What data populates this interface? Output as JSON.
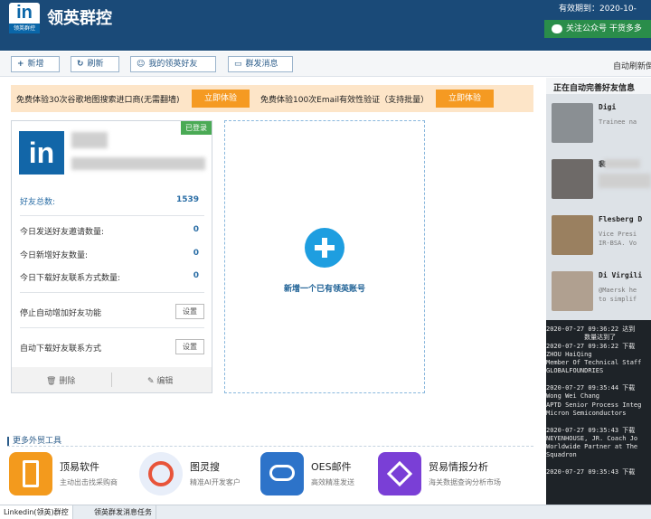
{
  "app": {
    "logo_text": "in",
    "logo_sub": "领英群控",
    "title": "领英群控",
    "expiry": "有效期到：2020-10-",
    "follow": "关注公众号 干货多多"
  },
  "toolbar": {
    "add": "新增",
    "refresh": "刷新",
    "friends": "我的领英好友",
    "message": "群发消息",
    "auto_refresh": "自动刷新倒"
  },
  "promo": {
    "text1": "免费体验30次谷歌地图搜索进口商(无需翻墙)",
    "btn1": "立即体验",
    "text2": "免费体验100次Email有效性验证（支持批量）",
    "btn2": "立即体验"
  },
  "account": {
    "status": "已登录",
    "logo": "in",
    "friends_total_label": "好友总数:",
    "friends_total": "1539",
    "rows": [
      {
        "label": "今日发送好友邀请数量:",
        "value": "0"
      },
      {
        "label": "今日新增好友数量:",
        "value": "0"
      },
      {
        "label": "今日下载好友联系方式数量:",
        "value": "0"
      }
    ],
    "stop_add": "停止自动增加好友功能",
    "auto_download": "自动下载好友联系方式",
    "set": "设置",
    "delete": "删除",
    "edit": "编辑"
  },
  "add_account": {
    "label": "新增一个已有领英账号"
  },
  "tools": {
    "header": "更多外贸工具",
    "items": [
      {
        "name": "顶易软件",
        "desc": "主动出击找采购商",
        "color": "#f39a1d"
      },
      {
        "name": "图灵搜",
        "desc": "精准AI开发客户",
        "color": "#e8eef9"
      },
      {
        "name": "OES邮件",
        "desc": "高效精准发送",
        "color": "#2d73c9"
      },
      {
        "name": "贸易情报分析",
        "desc": "海关数据查询分析市场",
        "color": "#7a3fd6"
      }
    ]
  },
  "tabs": [
    "Linkedin(领英)群控",
    "领英群发消息任务"
  ],
  "side": {
    "header": "正在自动完善好友信息",
    "people": [
      {
        "name": "Digi",
        "sub": "Trainee na"
      },
      {
        "name": "裴",
        "sub": ""
      },
      {
        "name": "Flesberg D",
        "sub": "Vice Presi\nIR-BSA. Vo"
      },
      {
        "name": "Di Virgili",
        "sub": "@Maersk he\nto simplif"
      }
    ],
    "log": "2020-07-27 09:36:22 达到\n          数量达到了\n2020-07-27 09:36:22 下载\nZHOU HaiQing\nMember Of Technical Staff\nGLOBALFOUNDRIES\n\n2020-07-27 09:35:44 下载\nWong Wei Chang\nAPTD Senior Process Integ\nMicron Semiconductors\n\n2020-07-27 09:35:43 下载\nNEYENHOUSE, JR. Coach Jo\nWorldwide Partner at The\nSquadron\n\n2020-07-27 09:35:43 下载"
  }
}
